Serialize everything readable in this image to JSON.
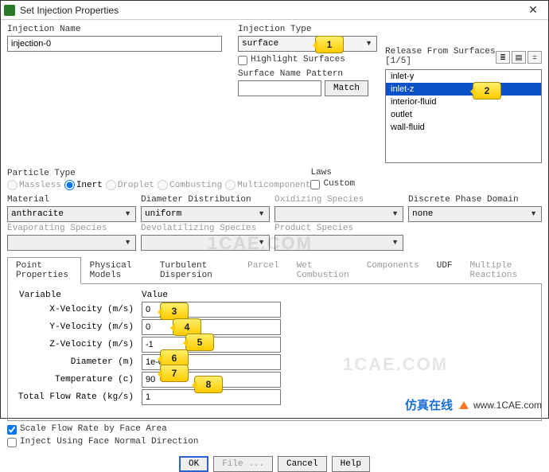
{
  "window": {
    "title": "Set Injection Properties"
  },
  "name_lbl": "Injection Name",
  "name_val": "injection-0",
  "type_lbl": "Injection Type",
  "type_val": "surface",
  "highlight": "Highlight Surfaces",
  "pattern_lbl": "Surface Name Pattern",
  "match_btn": "Match",
  "release_lbl": "Release From Surfaces [1/5]",
  "surfaces": {
    "items": [
      "inlet-y",
      "inlet-z",
      "interior-fluid",
      "outlet",
      "wall-fluid"
    ],
    "selectedIndex": 1
  },
  "ptype_lbl": "Particle Type",
  "ptypes": {
    "massless": "Massless",
    "inert": "Inert",
    "droplet": "Droplet",
    "combusting": "Combusting",
    "multi": "Multicomponent"
  },
  "laws_lbl": "Laws",
  "laws_custom": "Custom",
  "material_lbl": "Material",
  "material_val": "anthracite",
  "diamdist_lbl": "Diameter Distribution",
  "diamdist_val": "uniform",
  "oxid_lbl": "Oxidizing Species",
  "dpd_lbl": "Discrete Phase Domain",
  "dpd_val": "none",
  "evap_lbl": "Evaporating Species",
  "devol_lbl": "Devolatilizing Species",
  "prod_lbl": "Product Species",
  "tabs": {
    "point": "Point Properties",
    "phys": "Physical Models",
    "turb": "Turbulent Dispersion",
    "parcel": "Parcel",
    "wet": "Wet Combustion",
    "comp": "Components",
    "udf": "UDF",
    "mult": "Multiple Reactions"
  },
  "var_hdr": "Variable",
  "val_hdr": "Value",
  "vars": {
    "xv": {
      "lbl": "X-Velocity (m/s)",
      "val": "0"
    },
    "yv": {
      "lbl": "Y-Velocity (m/s)",
      "val": "0"
    },
    "zv": {
      "lbl": "Z-Velocity (m/s)",
      "val": "-1"
    },
    "dia": {
      "lbl": "Diameter (m)",
      "val": "1e-04"
    },
    "temp": {
      "lbl": "Temperature (c)",
      "val": "90"
    },
    "tfr": {
      "lbl": "Total Flow Rate (kg/s)",
      "val": "1"
    }
  },
  "scale_chk": "Scale Flow Rate by Face Area",
  "inject_chk": "Inject Using Face Normal Direction",
  "btns": {
    "ok": "OK",
    "file": "File ...",
    "cancel": "Cancel",
    "help": "Help"
  },
  "callouts": {
    "c1": "1",
    "c2": "2",
    "c3": "3",
    "c4": "4",
    "c5": "5",
    "c6": "6",
    "c7": "7",
    "c8": "8"
  },
  "watermark": "1CAE.COM",
  "brand": {
    "cn": "仿真在线",
    "en": "www.1CAE.com"
  }
}
